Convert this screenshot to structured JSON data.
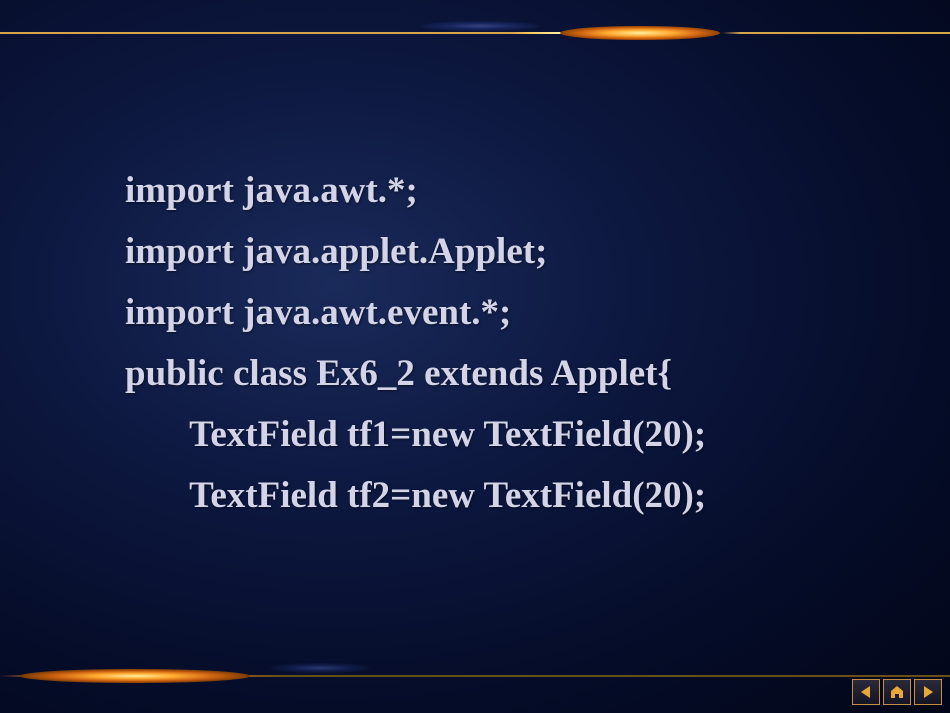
{
  "code": {
    "line1": "import java.awt.*;",
    "line2": "import java.applet.Applet;",
    "line3": "import java.awt.event.*;",
    "line4": "public class Ex6_2 extends Applet{",
    "line5": "       TextField tf1=new TextField(20);",
    "line6": "       TextField tf2=new TextField(20);"
  },
  "nav": {
    "prev_icon": "triangle-left",
    "home_icon": "home",
    "next_icon": "triangle-right",
    "icon_color": "#e8a838"
  }
}
